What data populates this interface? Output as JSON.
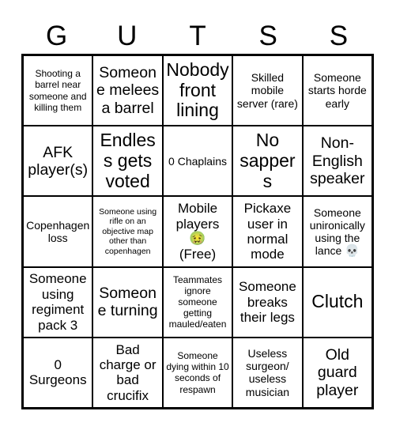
{
  "card": {
    "header_letters": [
      "G",
      "U",
      "T",
      "S",
      "S"
    ],
    "free_space_index": [
      2,
      2
    ],
    "colors": {
      "background": "#ffffff",
      "border": "#000000",
      "text": "#000000"
    },
    "rows": [
      [
        {
          "text": "Shooting a barrel near someone and killing them",
          "size": "fs-s"
        },
        {
          "text": "Someone melees a barrel",
          "size": "fs-xl"
        },
        {
          "text": "Nobody front lining",
          "size": "fs-xxl"
        },
        {
          "text": "Skilled mobile server (rare)",
          "size": "fs-m"
        },
        {
          "text": "Someone starts horde early",
          "size": "fs-m"
        }
      ],
      [
        {
          "text": "AFK player(s)",
          "size": "fs-xl"
        },
        {
          "text": "Endless gets voted",
          "size": "fs-xxl"
        },
        {
          "text": "0 Chaplains",
          "size": "fs-m"
        },
        {
          "text": "No sappers",
          "size": "fs-xxl"
        },
        {
          "text": "Non-English speaker",
          "size": "fs-xl"
        }
      ],
      [
        {
          "text": "Copenhagen loss",
          "size": "fs-m"
        },
        {
          "text": "Someone using rifle on an objective map other than copenhagen",
          "size": "fs-xs"
        },
        {
          "text": "Mobile players",
          "size": "fs-l",
          "emoji": "🤢",
          "suffix": "(Free)"
        },
        {
          "text": "Pickaxe user in normal mode",
          "size": "fs-l"
        },
        {
          "text": "Someone unironically using the lance",
          "size": "fs-m",
          "inline_emoji": "💀"
        }
      ],
      [
        {
          "text": "Someone using regiment pack 3",
          "size": "fs-l"
        },
        {
          "text": "Someone turning",
          "size": "fs-xl"
        },
        {
          "text": "Teammates ignore someone getting mauled/eaten",
          "size": "fs-s"
        },
        {
          "text": "Someone breaks their legs",
          "size": "fs-l"
        },
        {
          "text": "Clutch",
          "size": "fs-xxl"
        }
      ],
      [
        {
          "text": "0 Surgeons",
          "size": "fs-l"
        },
        {
          "text": "Bad charge or bad crucifix",
          "size": "fs-l"
        },
        {
          "text": "Someone dying within 10 seconds of respawn",
          "size": "fs-s"
        },
        {
          "text": "Useless surgeon/ useless musician",
          "size": "fs-m"
        },
        {
          "text": "Old guard player",
          "size": "fs-xl"
        }
      ]
    ]
  }
}
